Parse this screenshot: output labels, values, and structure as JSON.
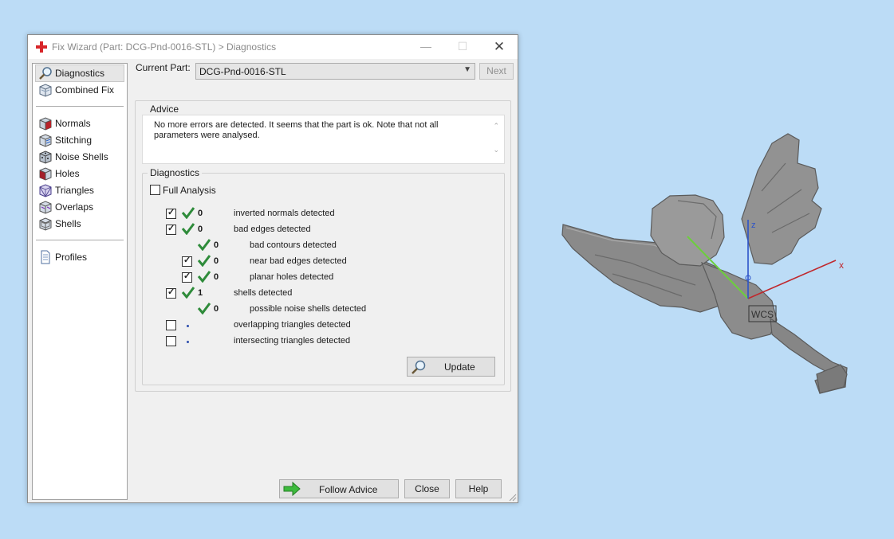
{
  "window": {
    "title": "Fix Wizard (Part: DCG-Pnd-0016-STL) > Diagnostics"
  },
  "nav": {
    "items": [
      {
        "label": "Diagnostics",
        "icon": "magnifier-icon"
      },
      {
        "label": "Combined Fix",
        "icon": "layered-cube-icon"
      },
      {
        "label": "Normals",
        "icon": "normals-cube-icon"
      },
      {
        "label": "Stitching",
        "icon": "stitching-cube-icon"
      },
      {
        "label": "Noise Shells",
        "icon": "noise-shells-cube-icon"
      },
      {
        "label": "Holes",
        "icon": "holes-cube-icon"
      },
      {
        "label": "Triangles",
        "icon": "triangles-cube-icon"
      },
      {
        "label": "Overlaps",
        "icon": "overlaps-cube-icon"
      },
      {
        "label": "Shells",
        "icon": "shells-cube-icon"
      },
      {
        "label": "Profiles",
        "icon": "document-icon"
      }
    ]
  },
  "header": {
    "current_part_label": "Current Part:",
    "current_part_value": "DCG-Pnd-0016-STL",
    "next_label": "Next"
  },
  "advice": {
    "title": "Advice",
    "text": "No more errors are detected. It seems that the part is ok. Note that not all parameters were analysed."
  },
  "diagnostics": {
    "title": "Diagnostics",
    "full_analysis_label": "Full Analysis",
    "rows": [
      {
        "count": "0",
        "text": "inverted normals detected"
      },
      {
        "count": "0",
        "text": "bad edges detected"
      },
      {
        "count": "0",
        "text": "bad contours detected"
      },
      {
        "count": "0",
        "text": "near bad edges detected"
      },
      {
        "count": "0",
        "text": "planar holes detected"
      },
      {
        "count": "1",
        "text": "shells detected"
      },
      {
        "count": "0",
        "text": "possible noise shells detected"
      },
      {
        "count": "",
        "text": "overlapping triangles detected"
      },
      {
        "count": "",
        "text": "intersecting triangles detected"
      }
    ],
    "update_label": "Update"
  },
  "footer": {
    "follow_advice_label": "Follow Advice",
    "close_label": "Close",
    "help_label": "Help"
  },
  "viewport": {
    "axis_x_label": "x",
    "axis_z_label": "z",
    "wcs_label": "WCS"
  },
  "colors": {
    "check_green": "#2e8b3a",
    "axis_x": "#c0282d",
    "axis_y": "#6ccf3c",
    "axis_z": "#2c53c9",
    "model_gray": "#8e8e8e"
  }
}
